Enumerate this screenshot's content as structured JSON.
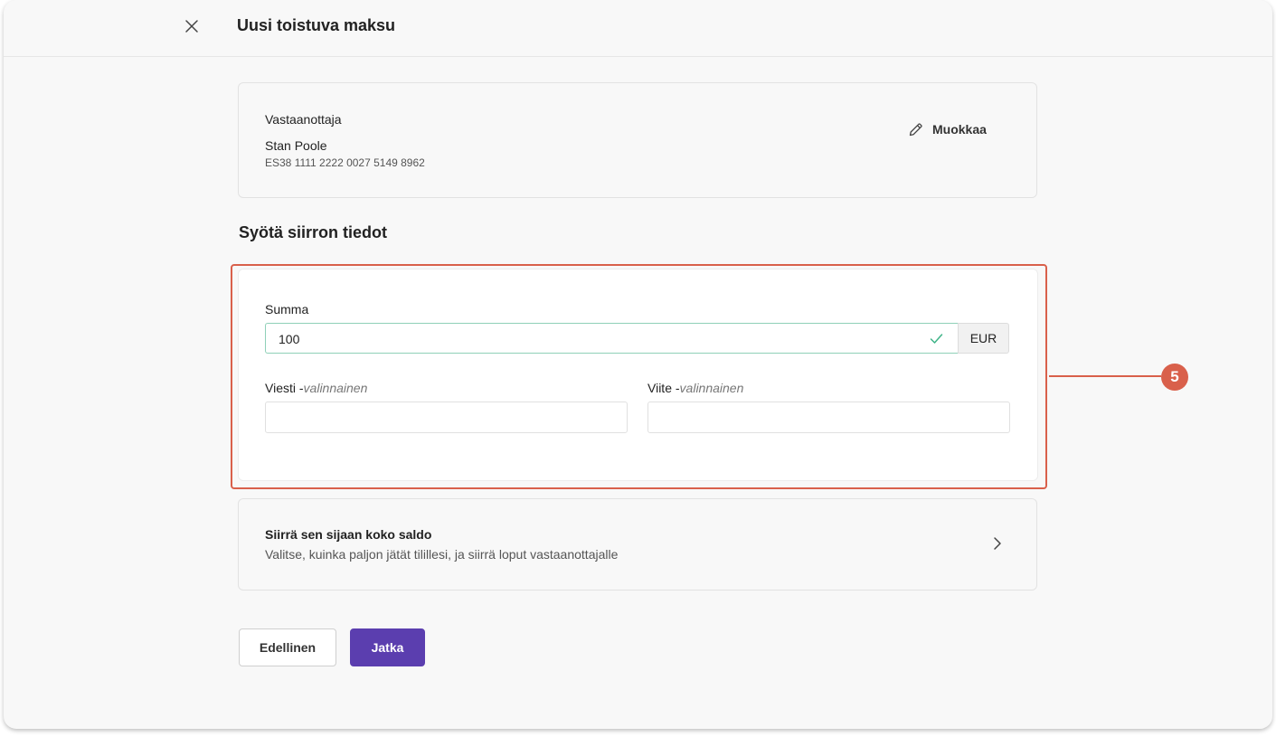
{
  "header": {
    "title": "Uusi toistuva maksu",
    "close_icon": "close-icon"
  },
  "recipient": {
    "label": "Vastaanottaja",
    "name": "Stan Poole",
    "iban": "ES38 1111 2222 0027 5149 8962",
    "edit_label": "Muokkaa",
    "edit_icon": "pencil-icon"
  },
  "section": {
    "title": "Syötä siirron tiedot"
  },
  "form": {
    "amount_label": "Summa",
    "amount_value": "100",
    "currency": "EUR",
    "message_label": "Viesti -",
    "message_optional": "valinnainen",
    "message_value": "",
    "reference_label": "Viite -",
    "reference_optional": "valinnainen",
    "reference_value": ""
  },
  "annotation": {
    "marker": "5",
    "color": "#d9604b"
  },
  "balance_option": {
    "title": "Siirrä sen sijaan koko saldo",
    "description": "Valitse, kuinka paljon jätät tilillesi, ja siirrä loput vastaanottajalle"
  },
  "footer": {
    "prev_label": "Edellinen",
    "next_label": "Jatka"
  },
  "colors": {
    "primary": "#5b3eaf",
    "valid_border": "#8fd0b8",
    "check": "#3fb488"
  }
}
